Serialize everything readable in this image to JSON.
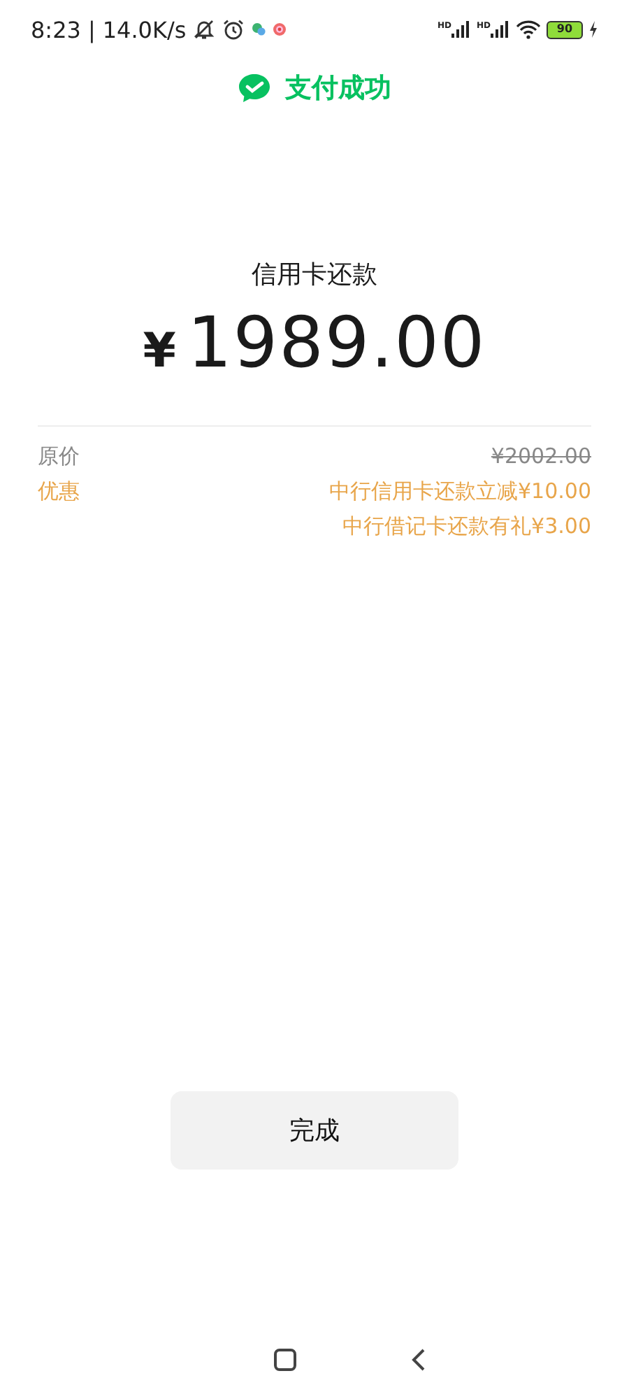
{
  "status_bar": {
    "time": "8:23",
    "separator": "|",
    "net_speed": "14.0K/s",
    "signals": [
      {
        "label": "HD"
      },
      {
        "label": "HD"
      }
    ],
    "battery": "90"
  },
  "header": {
    "title": "支付成功"
  },
  "payment": {
    "label": "信用卡还款",
    "currency": "¥",
    "amount": "1989.00"
  },
  "details": [
    {
      "kind": "original",
      "label": "原价",
      "values": [
        "¥2002.00"
      ],
      "strikethrough": true
    },
    {
      "kind": "discount",
      "label": "优惠",
      "values": [
        "中行信用卡还款立减¥10.00",
        "中行借记卡还款有礼¥3.00"
      ],
      "strikethrough": false
    }
  ],
  "done_button": "完成"
}
